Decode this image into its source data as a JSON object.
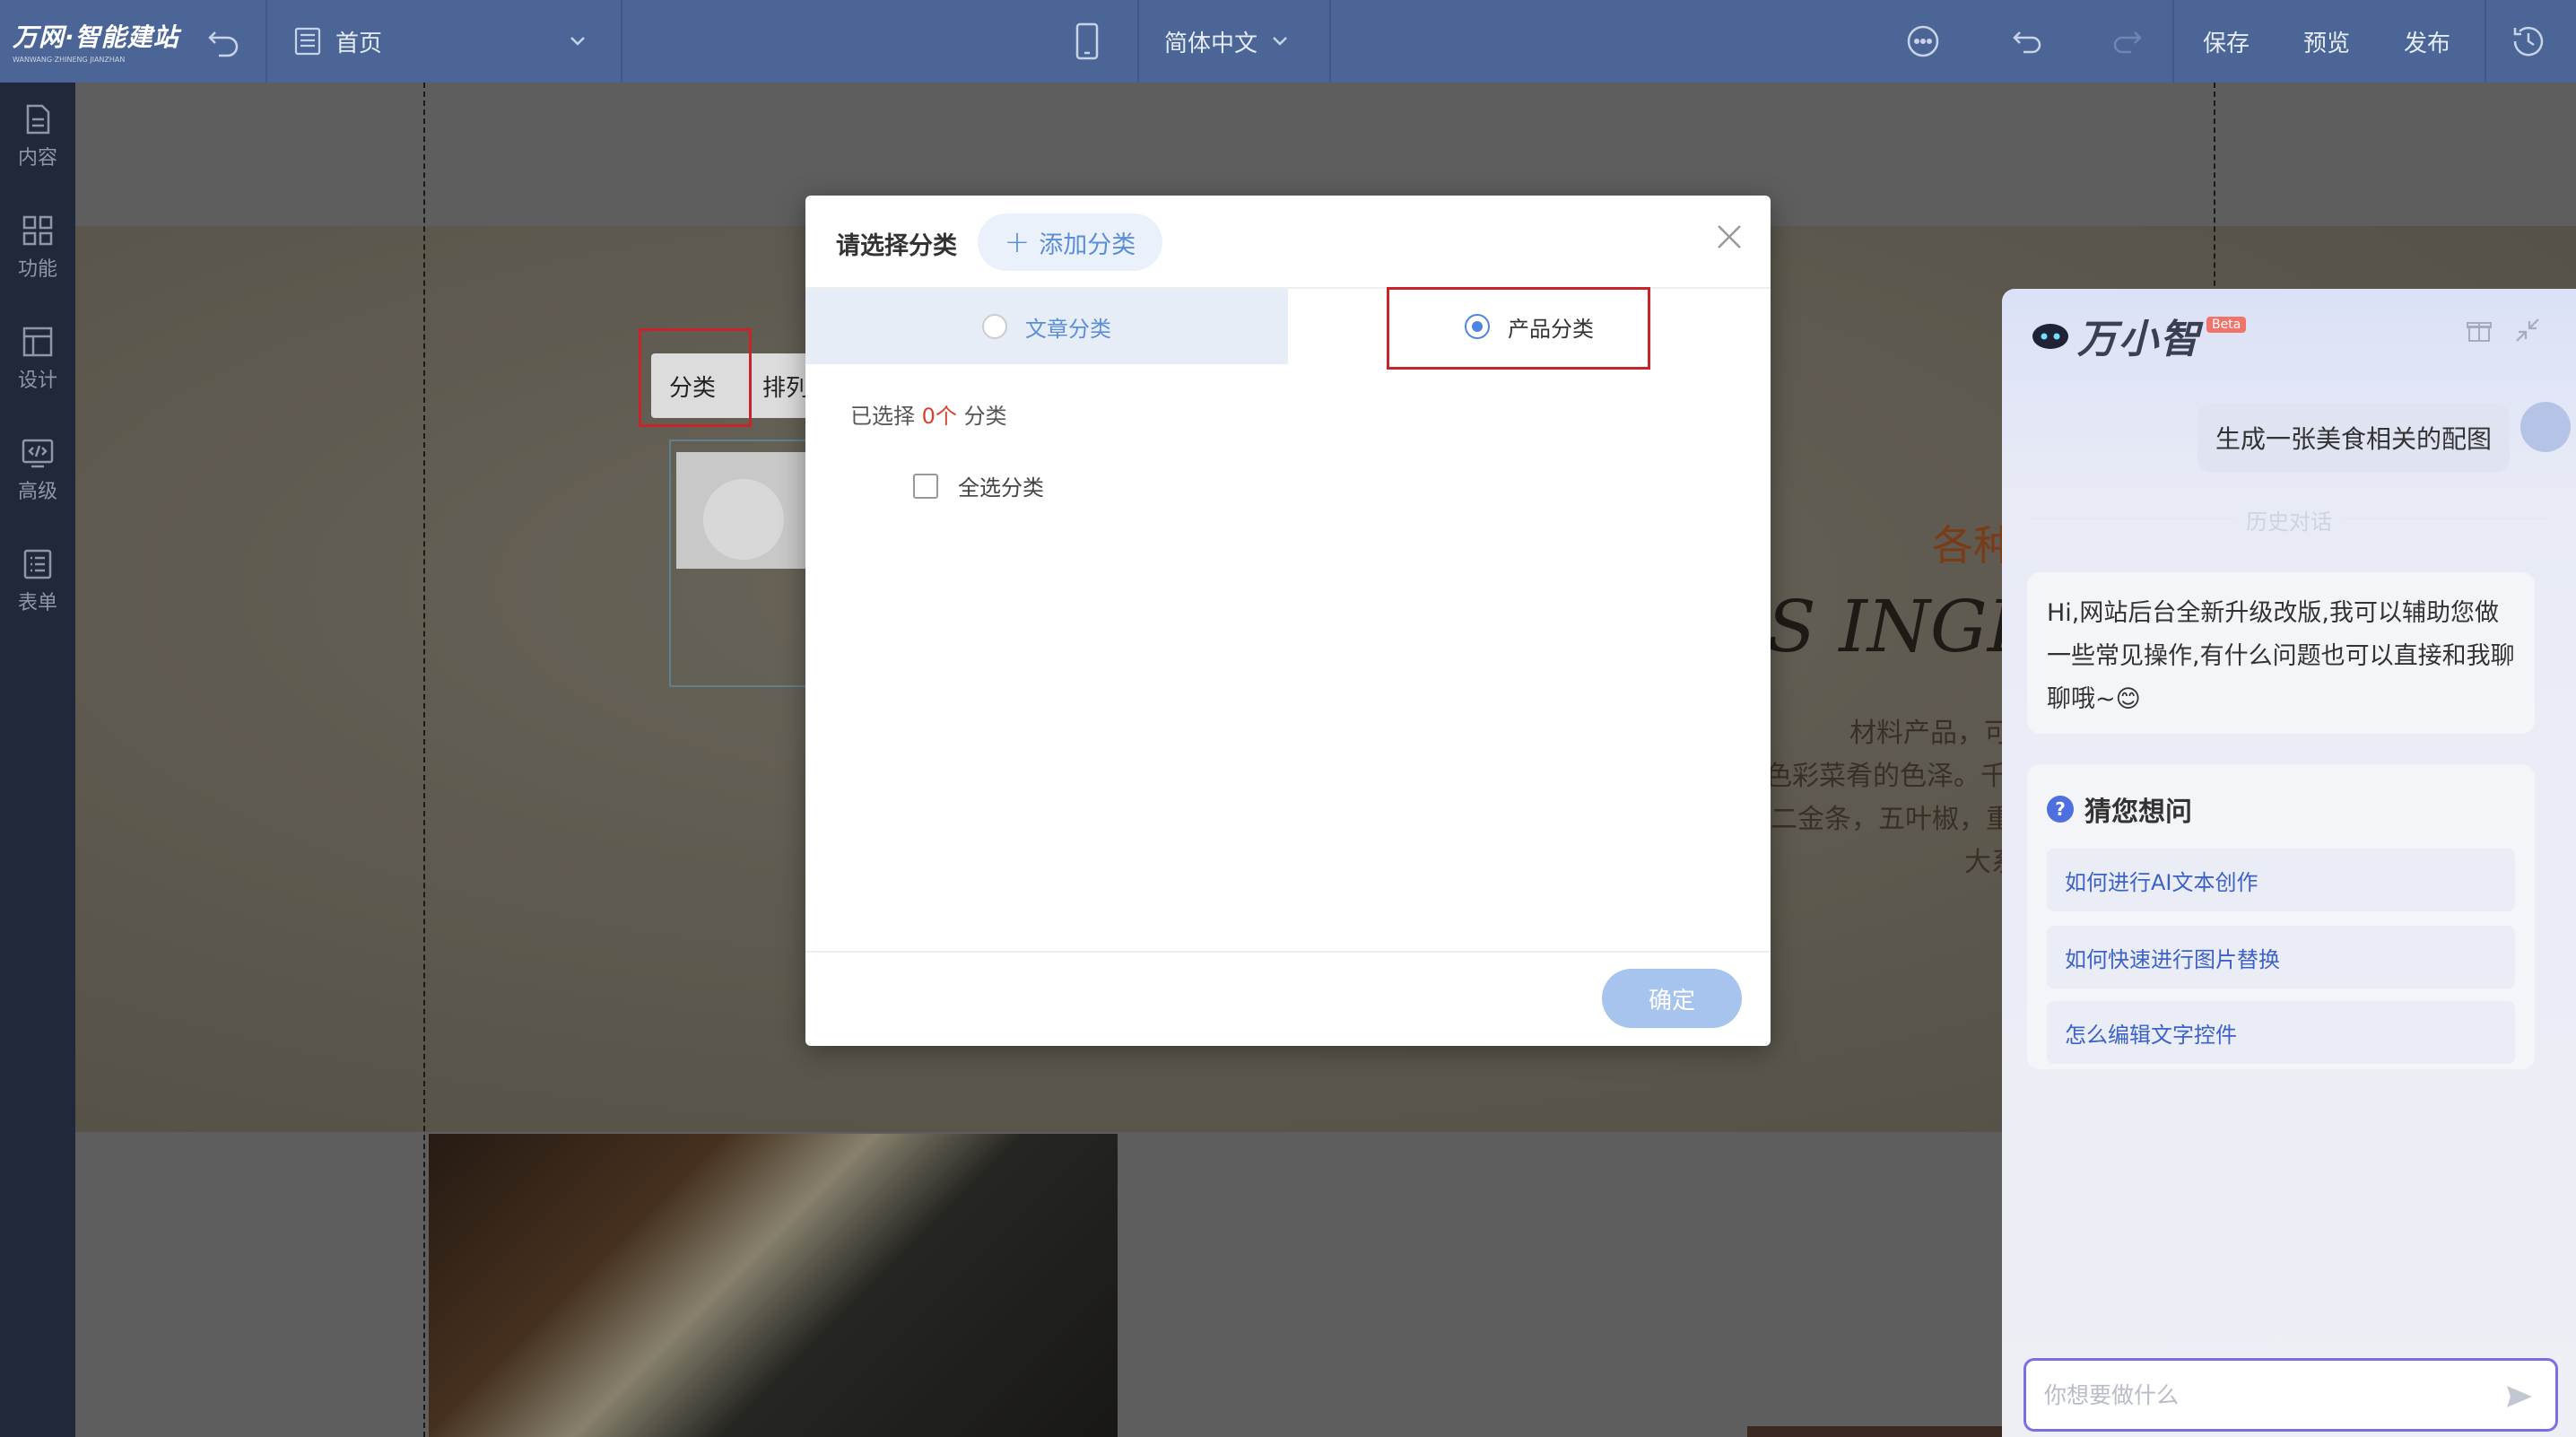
{
  "topbar": {
    "logo_main": "万网·智能建站",
    "logo_sub": "WANWANG·ZHINENG JIANZHAN",
    "page_label": "首页",
    "language": "简体中文",
    "save": "保存",
    "preview": "预览",
    "publish": "发布"
  },
  "sidebar": {
    "items": [
      {
        "label": "内容",
        "icon": "file-icon"
      },
      {
        "label": "功能",
        "icon": "grid-icon"
      },
      {
        "label": "设计",
        "icon": "layout-icon"
      },
      {
        "label": "高级",
        "icon": "code-icon"
      },
      {
        "label": "表单",
        "icon": "list-icon"
      }
    ]
  },
  "canvas": {
    "tab_category": "分类",
    "tab_sort": "排列",
    "heading_cn": "各种",
    "heading_en": "S INGREDI",
    "desc_line1": "材料产品，可",
    "desc_line2": "色彩菜肴的色泽。千",
    "desc_line3": "二金条，五叶椒，重",
    "desc_line4": "大系"
  },
  "modal": {
    "title": "请选择分类",
    "add_button": "添加分类",
    "tab_article": "文章分类",
    "tab_product": "产品分类",
    "selected_prefix": "已选择",
    "selected_count": "0个",
    "selected_suffix": "分类",
    "select_all": "全选分类",
    "ok_button": "确定"
  },
  "assistant": {
    "name": "万小智",
    "beta": "Beta",
    "user_message": "生成一张美食相关的配图",
    "history_label": "历史对话",
    "bot_message": "Hi,网站后台全新升级改版,我可以辅助您做一些常见操作,有什么问题也可以直接和我聊聊哦~😊",
    "guess_title": "猜您想问",
    "suggestions": [
      "如何进行AI文本创作",
      "如何快速进行图片替换",
      "怎么编辑文字控件"
    ],
    "input_placeholder": "你想要做什么"
  },
  "colors": {
    "topbar": "#4b6696",
    "sidebar": "#20293a",
    "accent": "#4c86e0",
    "highlight_red": "#c8252b",
    "count_red": "#d8412b"
  }
}
